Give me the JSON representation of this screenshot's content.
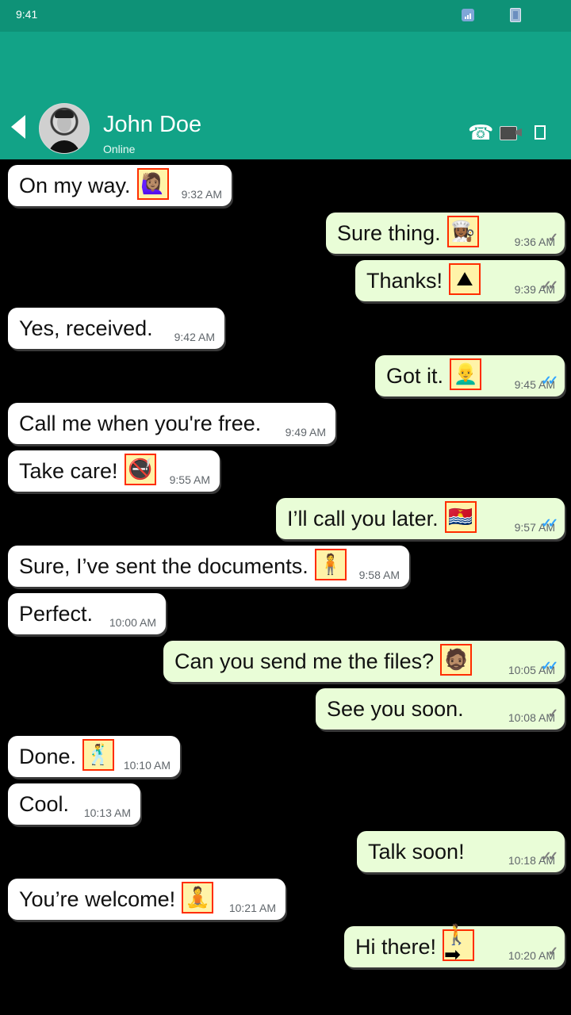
{
  "status_bar": {
    "time": "9:41",
    "signal_icon": "signal-icon",
    "battery_icon": "battery-icon"
  },
  "header": {
    "back_icon": "back-arrow-icon",
    "contact_name": "John Doe",
    "contact_status": "Online",
    "actions": [
      {
        "name": "voice-call-button",
        "icon": "phone-icon"
      },
      {
        "name": "video-call-button",
        "icon": "video-camera-icon"
      },
      {
        "name": "menu-button",
        "icon": "more-options-icon"
      }
    ]
  },
  "theme": {
    "header_color": "#12a387",
    "status_color": "#0e9277",
    "incoming_bubble": "#ffffff",
    "outgoing_bubble": "#e9fdd7",
    "read_tick": "#31a4ff"
  },
  "messages": [
    {
      "direction": "in",
      "text": "On my way.",
      "time": "9:32 AM",
      "emoji": "woman-raising-hand"
    },
    {
      "direction": "out",
      "text": "Sure thing.",
      "time": "9:36 AM",
      "emoji": "woman-cook",
      "status": "sent"
    },
    {
      "direction": "out",
      "text": "Thanks!",
      "time": "9:39 AM",
      "emoji": "mountain",
      "status": "delivered"
    },
    {
      "direction": "in",
      "text": "Yes, received.",
      "time": "9:42 AM"
    },
    {
      "direction": "out",
      "text": "Got it.",
      "time": "9:45 AM",
      "emoji": "man-blond",
      "status": "read"
    },
    {
      "direction": "in",
      "text": "Call me when you're free.",
      "time": "9:49 AM"
    },
    {
      "direction": "in",
      "text": "Take care!",
      "time": "9:55 AM",
      "emoji": "no-smoking"
    },
    {
      "direction": "out",
      "text": "I’ll call you later.",
      "time": "9:57 AM",
      "emoji": "flag-kiribati",
      "status": "read"
    },
    {
      "direction": "in",
      "text": "Sure, I’ve sent the documents.",
      "time": "9:58 AM",
      "emoji": "person-standing"
    },
    {
      "direction": "in",
      "text": "Perfect.",
      "time": "10:00 AM"
    },
    {
      "direction": "out",
      "text": "Can you send me the files?",
      "time": "10:05 AM",
      "emoji": "man-bearded",
      "status": "read"
    },
    {
      "direction": "out",
      "text": "See you soon.",
      "time": "10:08 AM",
      "status": "sent"
    },
    {
      "direction": "in",
      "text": "Done.",
      "time": "10:10 AM",
      "emoji": "man-dancing"
    },
    {
      "direction": "in",
      "text": "Cool.",
      "time": "10:13 AM"
    },
    {
      "direction": "out",
      "text": "Talk soon!",
      "time": "10:18 AM",
      "status": "delivered"
    },
    {
      "direction": "in",
      "text": "You’re welcome!",
      "time": "10:21 AM",
      "emoji": "person-lotus"
    },
    {
      "direction": "out",
      "text": "Hi there!",
      "time": "10:20 AM",
      "emoji": "walking-right-arrow",
      "status": "sent"
    }
  ]
}
